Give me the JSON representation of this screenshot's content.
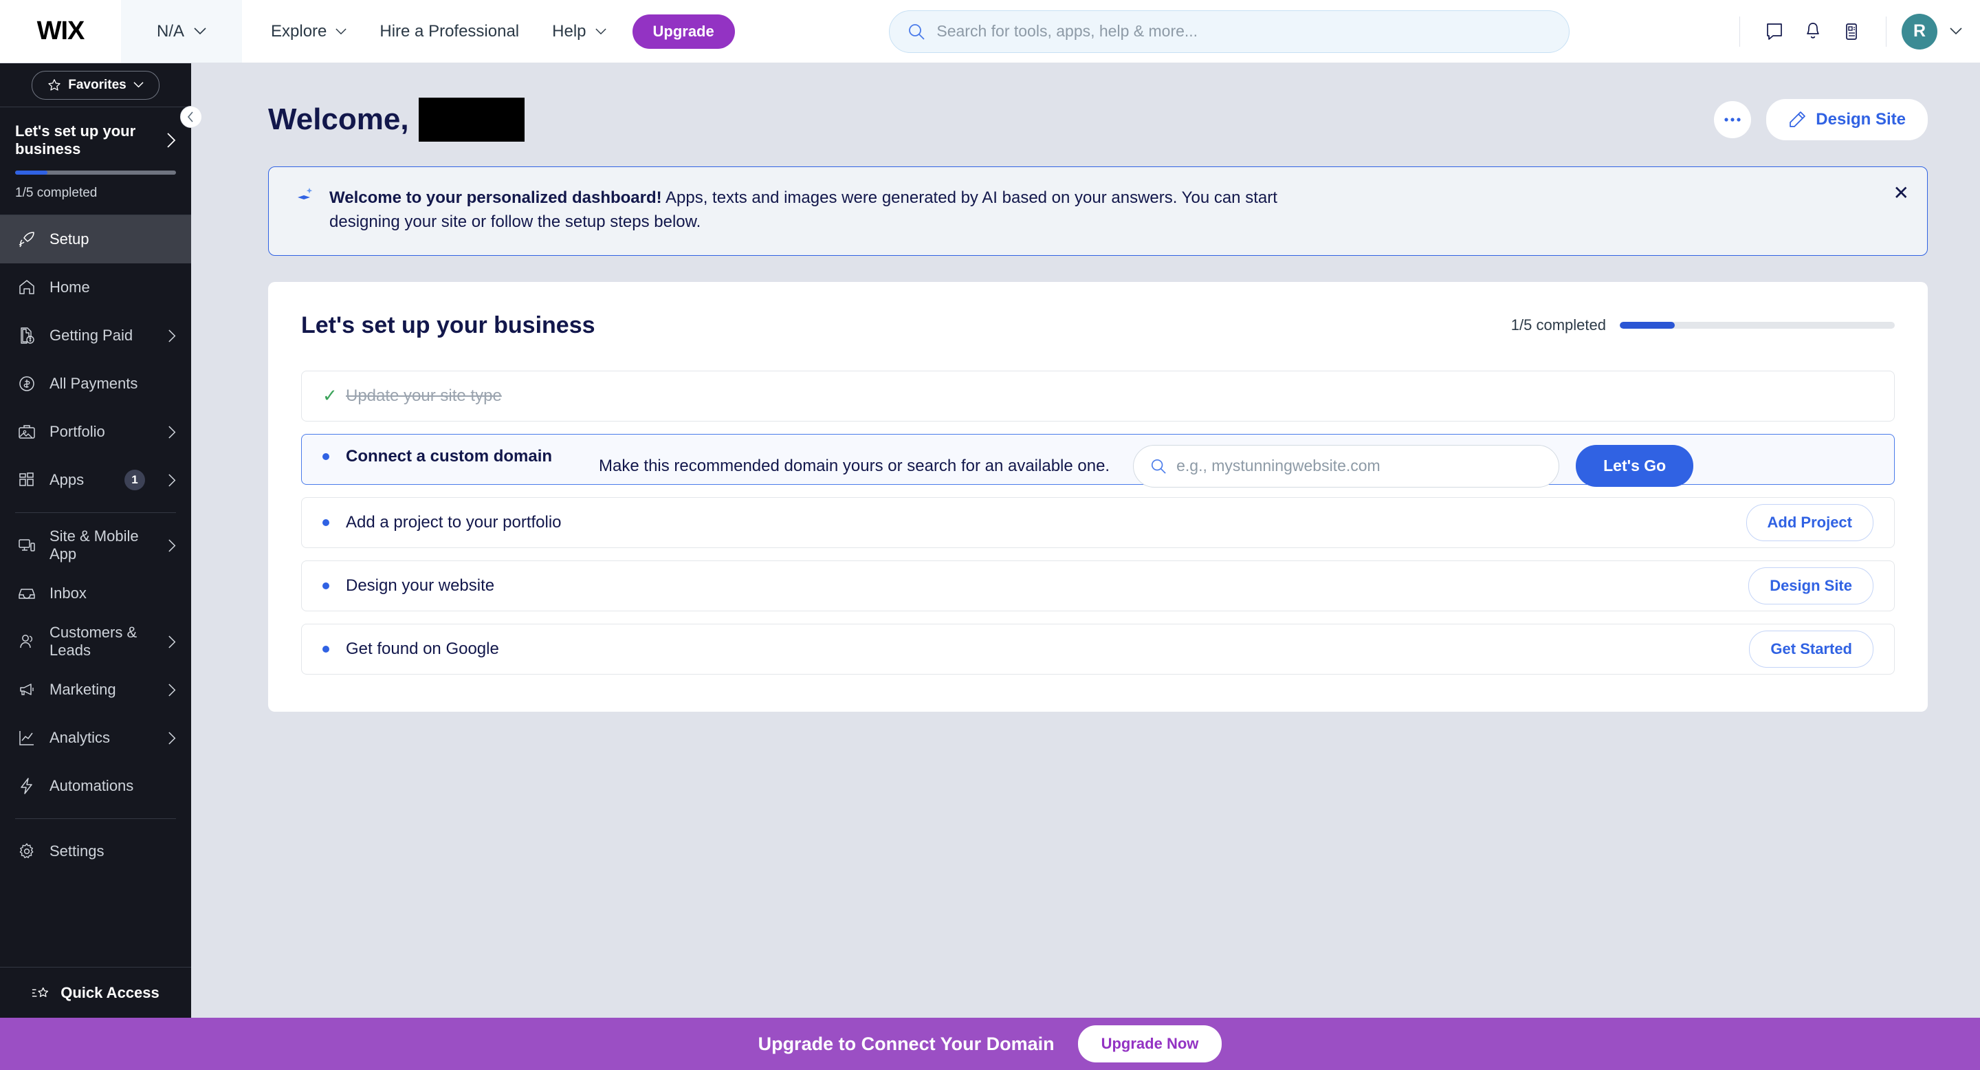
{
  "topbar": {
    "logo": "WIX",
    "site_selector": {
      "label": "N/A",
      "icon": "chevron-down-icon"
    },
    "nav": [
      {
        "label": "Explore",
        "has_chevron": true
      },
      {
        "label": "Hire a Professional",
        "has_chevron": false
      },
      {
        "label": "Help",
        "has_chevron": true
      }
    ],
    "upgrade_label": "Upgrade",
    "search": {
      "placeholder": "Search for tools, apps, help & more...",
      "value": ""
    },
    "icons": [
      "chat-icon",
      "bell-icon",
      "whats-new-icon"
    ],
    "avatar_initial": "R"
  },
  "sidebar": {
    "favorites_label": "Favorites",
    "setup": {
      "title": "Let's set up your business",
      "progress_label": "1/5 completed",
      "progress_percent": 20
    },
    "items": [
      {
        "label": "Setup",
        "icon": "rocket-icon",
        "active": true,
        "chevron": false,
        "badge": null
      },
      {
        "label": "Home",
        "icon": "home-icon",
        "active": false,
        "chevron": false,
        "badge": null
      },
      {
        "label": "Getting Paid",
        "icon": "invoice-dollar-icon",
        "active": false,
        "chevron": true,
        "badge": null
      },
      {
        "label": "All Payments",
        "icon": "dollar-circle-icon",
        "active": false,
        "chevron": false,
        "badge": null
      },
      {
        "label": "Portfolio",
        "icon": "portfolio-image-icon",
        "active": false,
        "chevron": true,
        "badge": null
      },
      {
        "label": "Apps",
        "icon": "apps-grid-icon",
        "active": false,
        "chevron": true,
        "badge": "1"
      }
    ],
    "items2": [
      {
        "label": "Site & Mobile App",
        "icon": "devices-icon",
        "active": false,
        "chevron": true,
        "badge": null
      },
      {
        "label": "Inbox",
        "icon": "inbox-icon",
        "active": false,
        "chevron": false,
        "badge": null
      },
      {
        "label": "Customers & Leads",
        "icon": "people-icon",
        "active": false,
        "chevron": true,
        "badge": null
      },
      {
        "label": "Marketing",
        "icon": "megaphone-icon",
        "active": false,
        "chevron": true,
        "badge": null
      },
      {
        "label": "Analytics",
        "icon": "chart-line-icon",
        "active": false,
        "chevron": true,
        "badge": null
      },
      {
        "label": "Automations",
        "icon": "lightning-icon",
        "active": false,
        "chevron": false,
        "badge": null
      }
    ],
    "items3": [
      {
        "label": "Settings",
        "icon": "gear-icon",
        "active": false,
        "chevron": false,
        "badge": null
      }
    ],
    "quick_access_label": "Quick Access"
  },
  "main": {
    "welcome_prefix": "Welcome,",
    "welcome_name_redacted": true,
    "more_label": "•••",
    "design_site_label": "Design Site",
    "ai_banner": {
      "bold": "Welcome to your personalized dashboard!",
      "rest": " Apps, texts and images were generated by AI based on your answers. You can start designing your site or follow the setup steps below.",
      "close_label": "✕"
    },
    "setup_card": {
      "title": "Let's set up your business",
      "progress_label": "1/5 completed",
      "progress_percent": 20,
      "steps": [
        {
          "label": "Update your site type",
          "done": true,
          "button": null
        },
        {
          "label": "Connect a custom domain",
          "done": false,
          "expanded": true,
          "description": "Make this recommended domain yours or search for an available one.",
          "input_placeholder": "e.g., mystunningwebsite.com",
          "input_value": "",
          "submit_label": "Let's Go"
        },
        {
          "label": "Add a project to your portfolio",
          "done": false,
          "button": "Add Project"
        },
        {
          "label": "Design your website",
          "done": false,
          "button": "Design Site"
        },
        {
          "label": "Get found on Google",
          "done": false,
          "button": "Get Started"
        }
      ]
    }
  },
  "bottom_banner": {
    "text": "Upgrade to Connect Your Domain",
    "button": "Upgrade Now"
  },
  "colors": {
    "accent_blue": "#3062e3",
    "brand_purple": "#9333c3",
    "banner_purple": "#9b4fc4",
    "sidebar_dark": "#15171f",
    "page_bg": "#dfe2ea",
    "success_green": "#3ba35a",
    "avatar_teal": "#3b8b94"
  }
}
